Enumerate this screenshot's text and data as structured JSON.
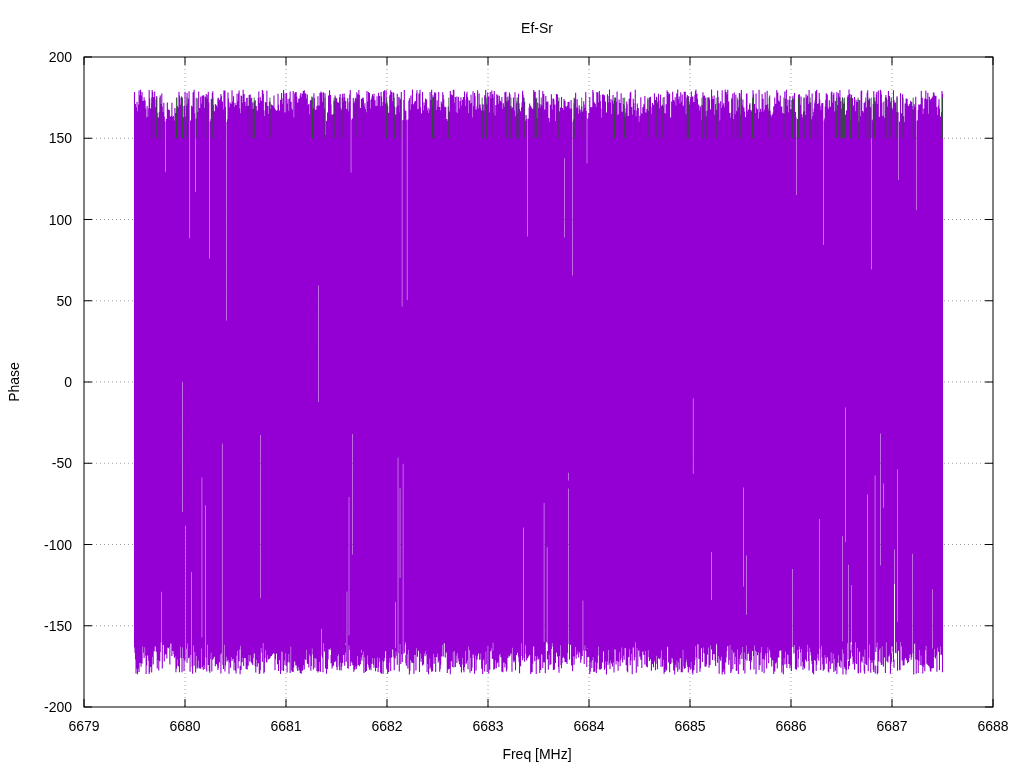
{
  "plot": {
    "title": "Ef-Sr",
    "xlabel": "Freq [MHz]",
    "ylabel": "Phase",
    "xticks": [
      "6679",
      "6680",
      "6681",
      "6682",
      "6683",
      "6684",
      "6685",
      "6686",
      "6687",
      "6688"
    ],
    "yticks": [
      "200",
      "150",
      "100",
      "50",
      "0",
      "-50",
      "-100",
      "-150",
      "-200"
    ]
  }
}
